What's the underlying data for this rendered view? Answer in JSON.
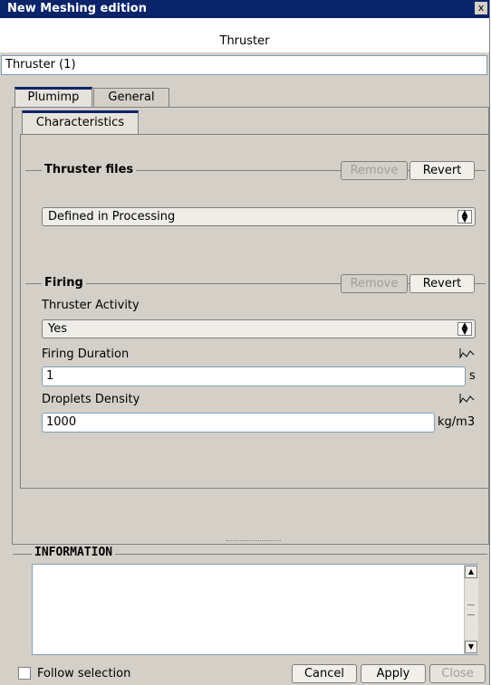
{
  "window": {
    "title": "New Meshing edition",
    "close_glyph": "x",
    "subtitle": "Thruster",
    "name_value": "Thruster (1)"
  },
  "tabs": [
    {
      "label": "Plumimp",
      "active": true
    },
    {
      "label": "General",
      "active": false
    }
  ],
  "subtab": {
    "label": "Characteristics"
  },
  "thruster_files": {
    "title": "Thruster files",
    "remove_label": "Remove",
    "revert_label": "Revert",
    "combo_value": "Defined in Processing"
  },
  "firing": {
    "title": "Firing",
    "remove_label": "Remove",
    "revert_label": "Revert",
    "activity_label": "Thruster Activity",
    "activity_value": "Yes",
    "duration_label": "Firing Duration",
    "duration_value": "1",
    "duration_unit": "s",
    "density_label": "Droplets Density",
    "density_value": "1000",
    "density_unit": "kg/m3"
  },
  "information": {
    "title": "INFORMATION",
    "text": ""
  },
  "footer": {
    "follow_label": "Follow selection",
    "follow_checked": false,
    "cancel_label": "Cancel",
    "apply_label": "Apply",
    "close_label": "Close"
  },
  "colors": {
    "titlebar": "#0a246a",
    "window_bg": "#d4d0c8",
    "disabled_text": "#a19e97"
  },
  "icons": {
    "graph": "graph-icon",
    "combo": "updown-arrows-icon"
  }
}
